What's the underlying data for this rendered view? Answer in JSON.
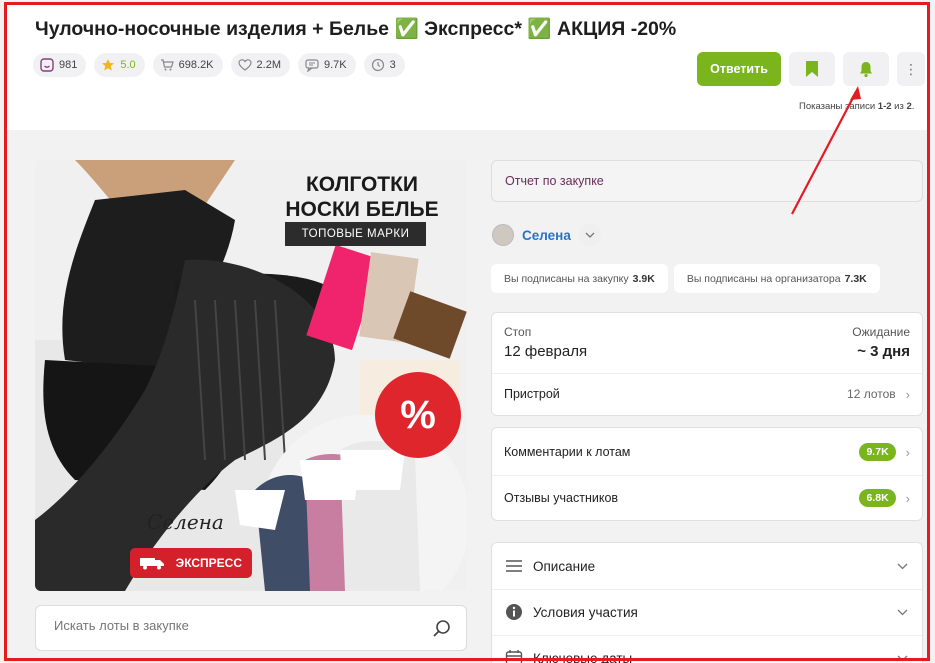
{
  "title": "Чулочно-носочные изделия + Белье ✅ Экспресс* ✅ АКЦИЯ -20%",
  "stats": {
    "rating_count": "981",
    "stars": "5.0",
    "orders": "698.2K",
    "likes": "2.2M",
    "comments": "9.7K",
    "history": "3"
  },
  "actions": {
    "reply_label": "Ответить",
    "bookmark_icon": "bookmark-icon",
    "bell_icon": "bell-icon"
  },
  "shown_text": {
    "prefix": "Показаны записи ",
    "range": "1-2",
    "mid": " из ",
    "total": "2",
    "suffix": "."
  },
  "banner": {
    "headline_line1": "КОЛГОТКИ",
    "headline_line2": "НОСКИ БЕЛЬЕ",
    "brands": "ТОПОВЫЕ МАРКИ",
    "signature": "Селена",
    "express": "ЭКСПРЕСС",
    "discount": "%"
  },
  "search": {
    "placeholder": "Искать лоты в закупке"
  },
  "report": "Отчет по закупке",
  "organizer": {
    "name": "Селена"
  },
  "subscriptions": {
    "purchase_label": "Вы подписаны на закупку",
    "purchase_count": "3.9K",
    "organizer_label": "Вы подписаны на организатора",
    "organizer_count": "7.3K"
  },
  "status": {
    "stop_label": "Стоп",
    "stop_value": "12 февраля",
    "wait_label": "Ожидание",
    "wait_value": "~ 3 дня",
    "attach_label": "Пристрой",
    "attach_value": "12 лотов"
  },
  "feedback": {
    "lot_comments_label": "Комментарии к лотам",
    "lot_comments_count": "9.7K",
    "reviews_label": "Отзывы участников",
    "reviews_count": "6.8K"
  },
  "sections": {
    "description": "Описание",
    "conditions": "Условия участия",
    "dates": "Ключевые даты"
  },
  "colors": {
    "accent_green": "#7ab51d",
    "link_blue": "#2a72c9",
    "annotation_red": "#e31b23"
  }
}
